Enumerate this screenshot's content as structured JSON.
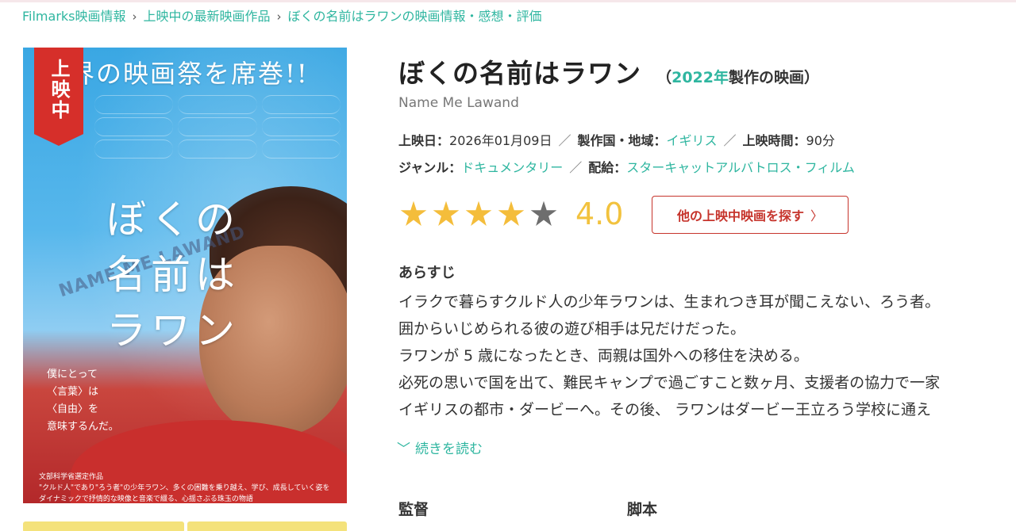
{
  "breadcrumb": [
    "Filmarks映画情報",
    "上映中の最新映画作品",
    "ぼくの名前はラワンの映画情報・感想・評価"
  ],
  "movie": {
    "title": "ぼくの名前はラワン",
    "year": "2022年",
    "year_suffix": "製作の映画",
    "original_title": "Name Me Lawand",
    "release_label": "上映日：",
    "release_date": "2026年01月09日",
    "country_label": "製作国・地域：",
    "country": "イギリス",
    "runtime_label": "上映時間：",
    "runtime": "90分",
    "genre_label": "ジャンル：",
    "genre": "ドキュメンタリー",
    "distributor_label": "配給：",
    "distributor": "スターキャットアルバトロス・フィルム"
  },
  "rating": {
    "score": "4.0",
    "value": 4.0,
    "max": 5,
    "star_color": "#f4bd3b"
  },
  "search_button": "他の上映中映画を探す",
  "synopsis": {
    "heading": "あらすじ",
    "lines": [
      "イラクで暮らすクルド人の少年ラワンは、生まれつき耳が聞こえない、ろう者。",
      "囲からいじめられる彼の遊び相手は兄だけだった。",
      "ラワンが 5 歳になったとき、両親は国外への移住を決める。",
      "必死の思いで国を出て、難民キャンプで過ごすこと数ヶ月、支援者の協力で一家",
      "イギリスの都市・ダービーへ。その後、 ラワンはダービー王立ろう学校に通え"
    ],
    "read_more": "続きを読む"
  },
  "staff": {
    "director_label": "監督",
    "writer_label": "脚本"
  },
  "poster": {
    "badge": "上映中",
    "headline": "界の映画祭を席巻!!",
    "title_lines": [
      "ぼくの",
      "名前は",
      "ラワン"
    ],
    "watermark": "NAME ME LAWAND",
    "tagline_lines": [
      "僕にとって",
      "〈言葉〉は",
      "〈自由〉を",
      "意味するんだ。"
    ],
    "footnote_lines": [
      "文部科学省選定作品",
      "\"クルド人\"であり\"ろう者\"の少年ラワン、多くの困難を乗り越え、学び、成長していく姿を",
      "ダイナミックで抒情的な映像と音楽で綴る、心揺さぶる珠玉の物語"
    ]
  },
  "colors": {
    "accent": "#2fb6a0",
    "danger": "#c6342c",
    "score": "#f2c23e"
  }
}
